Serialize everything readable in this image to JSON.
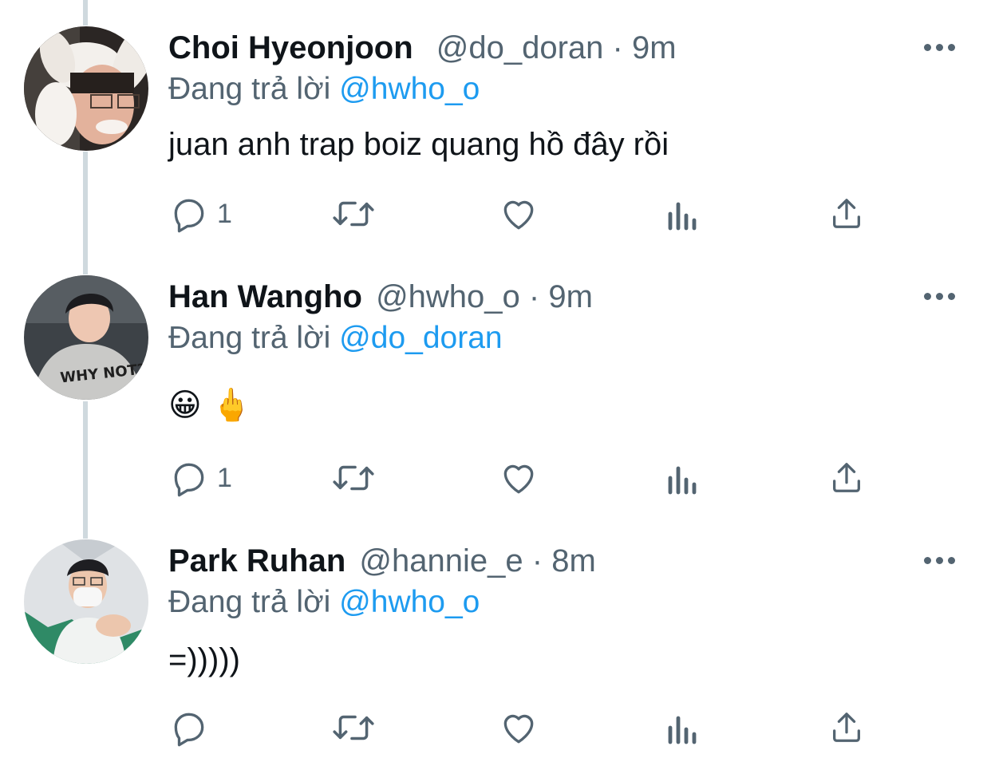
{
  "tweets": [
    {
      "name": "Choi Hyeonjoon",
      "handle": "@do_doran",
      "separator": "·",
      "time": "9m",
      "reply_prefix": "Đang trả lời",
      "reply_to": "@hwho_o",
      "text": "juan anh trap boiz quang hồ đây rồi",
      "reply_count": "1"
    },
    {
      "name": "Han Wangho",
      "handle": "@hwho_o",
      "separator": "·",
      "time": "9m",
      "reply_prefix": "Đang trả lời",
      "reply_to": "@do_doran",
      "text": "😀 🖕",
      "avatar_text": "WHY NOT?!",
      "reply_count": "1"
    },
    {
      "name": "Park Ruhan",
      "handle": "@hannie_e",
      "separator": "·",
      "time": "8m",
      "reply_prefix": "Đang trả lời",
      "reply_to": "@hwho_o",
      "text": "=)))))",
      "reply_count": ""
    }
  ],
  "icons": {
    "reply": "reply-icon",
    "retweet": "retweet-icon",
    "like": "heart-icon",
    "analytics": "analytics-icon",
    "share": "share-icon",
    "more": "more-icon"
  },
  "colors": {
    "text": "#0f1419",
    "muted": "#536471",
    "mention": "#1d9bf0",
    "thread_line": "#cfd9de"
  }
}
